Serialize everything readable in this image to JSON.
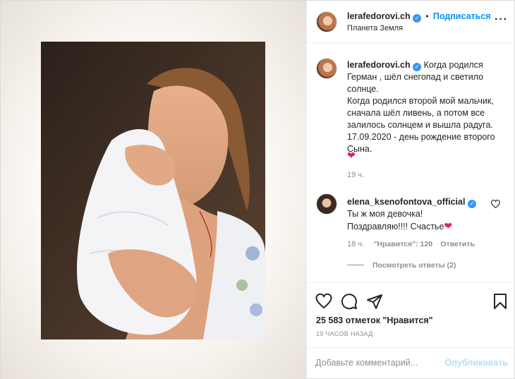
{
  "header": {
    "username": "lerafedorovi.ch",
    "separator": "•",
    "follow_label": "Подписаться",
    "location": "Планета Земля",
    "more_icon": "more-dots-icon"
  },
  "caption": {
    "username": "lerafedorovi.ch",
    "text": "Когда родился Герман , шёл снегопад и светило солнце.\nКогда родился второй мой мальчик, сначала шёл ливень, а потом все залилось солнцем и вышла радуга.\n17.09.2020 - день рождение второго Сына.",
    "emoji": "❤",
    "time": "19 ч."
  },
  "comment": {
    "username": "elena_ksenofontova_official",
    "text_line1": "Ты ж моя девочка!",
    "text_line2": "Поздравляю!!!! Счастье",
    "emoji": "❤",
    "time": "18 ч.",
    "likes": "\"Нравится\": 120",
    "reply_label": "Ответить",
    "view_replies": "Посмотреть ответы (2)"
  },
  "actions": {
    "likes_text": "25 583 отметок \"Нравится\"",
    "time_ago": "19 ЧАСОВ НАЗАД"
  },
  "add_comment": {
    "placeholder": "Добавьте комментарий...",
    "publish_label": "Опубликовать"
  },
  "colors": {
    "accent": "#0095f6",
    "verified": "#3897f0",
    "heart": "#e0245e"
  }
}
